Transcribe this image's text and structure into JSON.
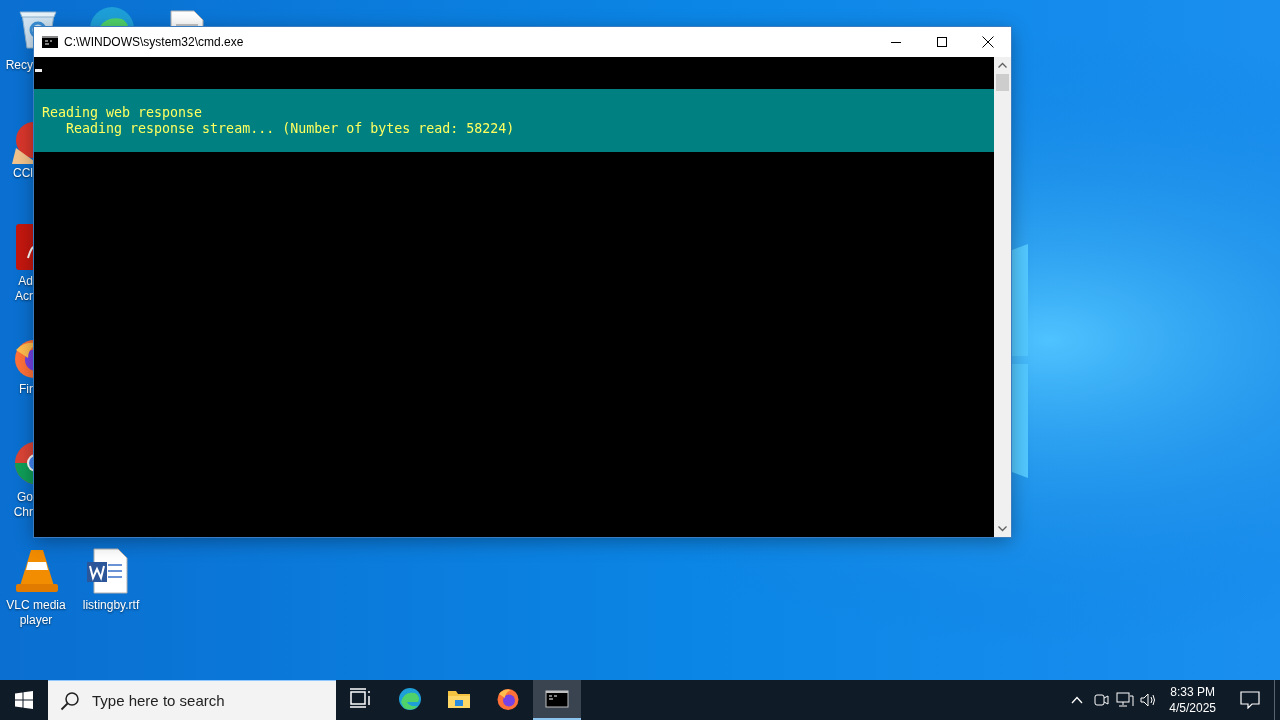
{
  "desktop": {
    "icons": [
      {
        "kind": "recycle",
        "lines": [
          "Recy"
        ]
      },
      {
        "kind": "edge"
      },
      {
        "kind": "document"
      },
      {
        "kind": "ccleaner",
        "lines": [
          "CCl"
        ]
      },
      {
        "kind": "acrobat",
        "lines": [
          "Ad",
          "Acr"
        ]
      },
      {
        "kind": "firefox",
        "lines": [
          "Fir"
        ]
      },
      {
        "kind": "chrome",
        "lines": [
          "Go",
          "Chr"
        ]
      },
      {
        "kind": "vlc",
        "lines": [
          "VLC media",
          "player"
        ]
      },
      {
        "kind": "word",
        "lines": [
          "listingby.rtf"
        ]
      }
    ]
  },
  "window": {
    "title": "C:\\WINDOWS\\system32\\cmd.exe",
    "progress": {
      "lines": [
        "Reading web response",
        "   Reading response stream... (Number of bytes read: 58224)"
      ]
    }
  },
  "taskbar": {
    "search": {
      "placeholder": "Type here to search"
    },
    "apps": [
      {
        "kind": "taskview",
        "selected": false
      },
      {
        "kind": "edge",
        "selected": false
      },
      {
        "kind": "explorer",
        "selected": false
      },
      {
        "kind": "firefox",
        "selected": false
      },
      {
        "kind": "cmd",
        "selected": true
      }
    ],
    "clock": {
      "time": "8:33 PM",
      "date": "4/5/2025"
    }
  }
}
